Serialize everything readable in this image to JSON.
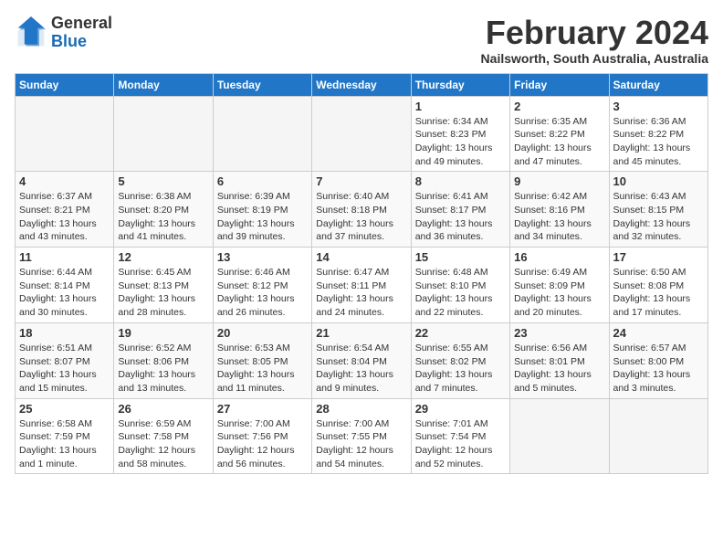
{
  "header": {
    "logo_general": "General",
    "logo_blue": "Blue",
    "month_title": "February 2024",
    "location": "Nailsworth, South Australia, Australia"
  },
  "weekdays": [
    "Sunday",
    "Monday",
    "Tuesday",
    "Wednesday",
    "Thursday",
    "Friday",
    "Saturday"
  ],
  "weeks": [
    [
      {
        "day": "",
        "info": ""
      },
      {
        "day": "",
        "info": ""
      },
      {
        "day": "",
        "info": ""
      },
      {
        "day": "",
        "info": ""
      },
      {
        "day": "1",
        "info": "Sunrise: 6:34 AM\nSunset: 8:23 PM\nDaylight: 13 hours\nand 49 minutes."
      },
      {
        "day": "2",
        "info": "Sunrise: 6:35 AM\nSunset: 8:22 PM\nDaylight: 13 hours\nand 47 minutes."
      },
      {
        "day": "3",
        "info": "Sunrise: 6:36 AM\nSunset: 8:22 PM\nDaylight: 13 hours\nand 45 minutes."
      }
    ],
    [
      {
        "day": "4",
        "info": "Sunrise: 6:37 AM\nSunset: 8:21 PM\nDaylight: 13 hours\nand 43 minutes."
      },
      {
        "day": "5",
        "info": "Sunrise: 6:38 AM\nSunset: 8:20 PM\nDaylight: 13 hours\nand 41 minutes."
      },
      {
        "day": "6",
        "info": "Sunrise: 6:39 AM\nSunset: 8:19 PM\nDaylight: 13 hours\nand 39 minutes."
      },
      {
        "day": "7",
        "info": "Sunrise: 6:40 AM\nSunset: 8:18 PM\nDaylight: 13 hours\nand 37 minutes."
      },
      {
        "day": "8",
        "info": "Sunrise: 6:41 AM\nSunset: 8:17 PM\nDaylight: 13 hours\nand 36 minutes."
      },
      {
        "day": "9",
        "info": "Sunrise: 6:42 AM\nSunset: 8:16 PM\nDaylight: 13 hours\nand 34 minutes."
      },
      {
        "day": "10",
        "info": "Sunrise: 6:43 AM\nSunset: 8:15 PM\nDaylight: 13 hours\nand 32 minutes."
      }
    ],
    [
      {
        "day": "11",
        "info": "Sunrise: 6:44 AM\nSunset: 8:14 PM\nDaylight: 13 hours\nand 30 minutes."
      },
      {
        "day": "12",
        "info": "Sunrise: 6:45 AM\nSunset: 8:13 PM\nDaylight: 13 hours\nand 28 minutes."
      },
      {
        "day": "13",
        "info": "Sunrise: 6:46 AM\nSunset: 8:12 PM\nDaylight: 13 hours\nand 26 minutes."
      },
      {
        "day": "14",
        "info": "Sunrise: 6:47 AM\nSunset: 8:11 PM\nDaylight: 13 hours\nand 24 minutes."
      },
      {
        "day": "15",
        "info": "Sunrise: 6:48 AM\nSunset: 8:10 PM\nDaylight: 13 hours\nand 22 minutes."
      },
      {
        "day": "16",
        "info": "Sunrise: 6:49 AM\nSunset: 8:09 PM\nDaylight: 13 hours\nand 20 minutes."
      },
      {
        "day": "17",
        "info": "Sunrise: 6:50 AM\nSunset: 8:08 PM\nDaylight: 13 hours\nand 17 minutes."
      }
    ],
    [
      {
        "day": "18",
        "info": "Sunrise: 6:51 AM\nSunset: 8:07 PM\nDaylight: 13 hours\nand 15 minutes."
      },
      {
        "day": "19",
        "info": "Sunrise: 6:52 AM\nSunset: 8:06 PM\nDaylight: 13 hours\nand 13 minutes."
      },
      {
        "day": "20",
        "info": "Sunrise: 6:53 AM\nSunset: 8:05 PM\nDaylight: 13 hours\nand 11 minutes."
      },
      {
        "day": "21",
        "info": "Sunrise: 6:54 AM\nSunset: 8:04 PM\nDaylight: 13 hours\nand 9 minutes."
      },
      {
        "day": "22",
        "info": "Sunrise: 6:55 AM\nSunset: 8:02 PM\nDaylight: 13 hours\nand 7 minutes."
      },
      {
        "day": "23",
        "info": "Sunrise: 6:56 AM\nSunset: 8:01 PM\nDaylight: 13 hours\nand 5 minutes."
      },
      {
        "day": "24",
        "info": "Sunrise: 6:57 AM\nSunset: 8:00 PM\nDaylight: 13 hours\nand 3 minutes."
      }
    ],
    [
      {
        "day": "25",
        "info": "Sunrise: 6:58 AM\nSunset: 7:59 PM\nDaylight: 13 hours\nand 1 minute."
      },
      {
        "day": "26",
        "info": "Sunrise: 6:59 AM\nSunset: 7:58 PM\nDaylight: 12 hours\nand 58 minutes."
      },
      {
        "day": "27",
        "info": "Sunrise: 7:00 AM\nSunset: 7:56 PM\nDaylight: 12 hours\nand 56 minutes."
      },
      {
        "day": "28",
        "info": "Sunrise: 7:00 AM\nSunset: 7:55 PM\nDaylight: 12 hours\nand 54 minutes."
      },
      {
        "day": "29",
        "info": "Sunrise: 7:01 AM\nSunset: 7:54 PM\nDaylight: 12 hours\nand 52 minutes."
      },
      {
        "day": "",
        "info": ""
      },
      {
        "day": "",
        "info": ""
      }
    ]
  ]
}
